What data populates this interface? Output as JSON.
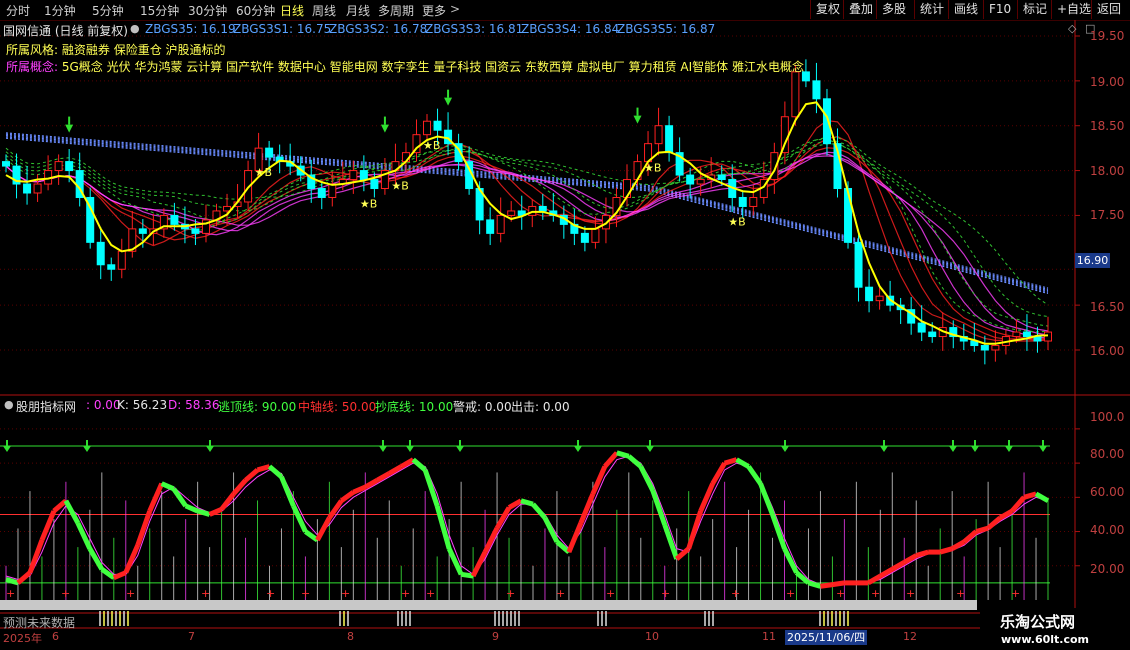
{
  "toolbar": {
    "periods": [
      "分时",
      "1分钟",
      "5分钟",
      "15分钟",
      "30分钟",
      "60分钟",
      "日线",
      "周线",
      "月线",
      "多周期",
      "更多"
    ],
    "active_period": "日线",
    "buttons": [
      "复权",
      "叠加",
      "多股",
      "统计",
      "画线",
      "F10",
      "标记",
      "+自选",
      "返回"
    ]
  },
  "main_title": "国网信通 (日线 前复权)",
  "ma_legend": [
    {
      "label": "ZBGS35: 16.19",
      "color": "#5aa0ff"
    },
    {
      "label": "ZBGS3S1: 16.75",
      "color": "#5aa0ff"
    },
    {
      "label": "ZBGS3S2: 16.78",
      "color": "#5aa0ff"
    },
    {
      "label": "ZBGS3S3: 16.81",
      "color": "#5aa0ff"
    },
    {
      "label": "ZBGS3S4: 16.84",
      "color": "#5aa0ff"
    },
    {
      "label": "ZBGS3S5: 16.87",
      "color": "#5aa0ff"
    }
  ],
  "info": {
    "style_label": "所属风格:",
    "style_value": "融资融券 保险重仓 沪股通标的",
    "concept_label": "所属概念:",
    "concept_value": "5G概念 光伏 华为鸿蒙 云计算 国产软件 数据中心 智能电网 数字孪生 量子科技 国资云 东数西算 虚拟电厂 算力租赁 AI智能体 雅江水电概念"
  },
  "indicator_legend": [
    {
      "label": "股朋指标网",
      "color": "#e6e6e6"
    },
    {
      "label": ": 0.00",
      "color": "#ff40ff"
    },
    {
      "label": "K: 56.23",
      "color": "#e6e6e6"
    },
    {
      "label": "D: 58.36",
      "color": "#ff40ff"
    },
    {
      "label": "逃顶线: 90.00",
      "color": "#40ff40"
    },
    {
      "label": "中轴线: 50.00",
      "color": "#ff3030"
    },
    {
      "label": "抄底线: 10.00",
      "color": "#40ff40"
    },
    {
      "label": "警戒: 0.00",
      "color": "#e6e6e6"
    },
    {
      "label": "出击: 0.00",
      "color": "#e6e6e6"
    }
  ],
  "price_axis": [
    "19.50",
    "19.00",
    "18.50",
    "18.00",
    "17.50",
    "16.50",
    "16.00"
  ],
  "current_price": "16.90",
  "indicator_axis": [
    "100.0",
    "80.00",
    "60.00",
    "40.00",
    "20.00"
  ],
  "date_axis": [
    {
      "label": "2025年",
      "x": 3
    },
    {
      "label": "6",
      "x": 52
    },
    {
      "label": "7",
      "x": 188
    },
    {
      "label": "8",
      "x": 347
    },
    {
      "label": "9",
      "x": 492
    },
    {
      "label": "10",
      "x": 645
    },
    {
      "label": "11",
      "x": 762
    },
    {
      "label": "12",
      "x": 903
    }
  ],
  "cursor_date": "2025/11/06/四",
  "future_text": "预测未来数据",
  "buy_label": "★B",
  "watermark": {
    "title": "乐淘公式网",
    "url": "www.60lt.com"
  },
  "colors": {
    "up": "#ff2020",
    "down": "#00ffff",
    "ma5": "#ffff00",
    "band": "#ff40ff",
    "kline_k": "#ff2020",
    "kline_d": "#40ff40"
  },
  "chart_data": [
    {
      "type": "candlestick",
      "ylim": [
        15.85,
        19.55
      ],
      "close": [
        18.05,
        17.85,
        17.75,
        17.85,
        18.0,
        18.1,
        18.0,
        17.7,
        17.2,
        16.95,
        16.9,
        17.1,
        17.35,
        17.3,
        17.35,
        17.5,
        17.4,
        17.35,
        17.3,
        17.45,
        17.55,
        17.6,
        17.65,
        18.0,
        18.25,
        18.15,
        18.1,
        18.05,
        17.95,
        17.8,
        17.7,
        17.85,
        17.9,
        18.0,
        17.9,
        17.8,
        18.0,
        18.1,
        18.2,
        18.4,
        18.55,
        18.45,
        18.3,
        18.1,
        17.8,
        17.45,
        17.3,
        17.5,
        17.55,
        17.5,
        17.6,
        17.55,
        17.5,
        17.4,
        17.3,
        17.2,
        17.35,
        17.5,
        17.7,
        17.9,
        18.1,
        18.3,
        18.5,
        18.2,
        17.95,
        17.85,
        17.9,
        17.95,
        17.9,
        17.7,
        17.6,
        17.7,
        17.9,
        18.2,
        18.6,
        19.1,
        19.0,
        18.8,
        18.3,
        17.8,
        17.2,
        16.7,
        16.55,
        16.6,
        16.5,
        16.45,
        16.3,
        16.2,
        16.15,
        16.25,
        16.15,
        16.1,
        16.05,
        16.0,
        16.05,
        16.15,
        16.2,
        16.15,
        16.1,
        16.2
      ],
      "series": [
        {
          "name": "ZBGS35",
          "last": 16.19
        },
        {
          "name": "ZBGS3S1",
          "last": 16.75
        },
        {
          "name": "ZBGS3S2",
          "last": 16.78
        },
        {
          "name": "ZBGS3S3",
          "last": 16.81
        },
        {
          "name": "ZBGS3S4",
          "last": 16.84
        },
        {
          "name": "ZBGS3S5",
          "last": 16.87
        }
      ]
    },
    {
      "type": "line",
      "ylim": [
        0,
        105
      ],
      "k": [
        12,
        10,
        16,
        35,
        52,
        58,
        45,
        30,
        18,
        13,
        16,
        32,
        52,
        68,
        65,
        55,
        52,
        50,
        53,
        62,
        70,
        76,
        78,
        72,
        55,
        40,
        35,
        48,
        58,
        63,
        66,
        70,
        74,
        78,
        82,
        76,
        55,
        30,
        15,
        14,
        28,
        42,
        54,
        58,
        56,
        48,
        34,
        28,
        45,
        62,
        78,
        86,
        84,
        78,
        64,
        44,
        24,
        30,
        52,
        68,
        80,
        82,
        78,
        68,
        50,
        30,
        16,
        10,
        8,
        9,
        10,
        10,
        10,
        14,
        18,
        22,
        26,
        28,
        28,
        30,
        34,
        40,
        42,
        48,
        52,
        60,
        62,
        58
      ],
      "d": [
        14,
        12,
        14,
        28,
        45,
        55,
        50,
        36,
        22,
        15,
        15,
        26,
        46,
        62,
        66,
        60,
        54,
        51,
        52,
        58,
        66,
        72,
        76,
        74,
        60,
        46,
        38,
        44,
        54,
        60,
        64,
        68,
        72,
        76,
        80,
        78,
        62,
        38,
        20,
        15,
        24,
        38,
        50,
        56,
        56,
        50,
        38,
        30,
        40,
        56,
        72,
        82,
        84,
        80,
        68,
        50,
        30,
        28,
        46,
        62,
        76,
        80,
        78,
        70,
        54,
        36,
        20,
        12,
        9,
        9,
        10,
        10,
        10,
        12,
        16,
        20,
        24,
        27,
        28,
        29,
        32,
        38,
        41,
        46,
        50,
        56,
        60,
        58
      ],
      "lines": [
        {
          "name": "逃顶线",
          "value": 90
        },
        {
          "name": "中轴线",
          "value": 50
        },
        {
          "name": "抄底线",
          "value": 10
        }
      ]
    }
  ]
}
